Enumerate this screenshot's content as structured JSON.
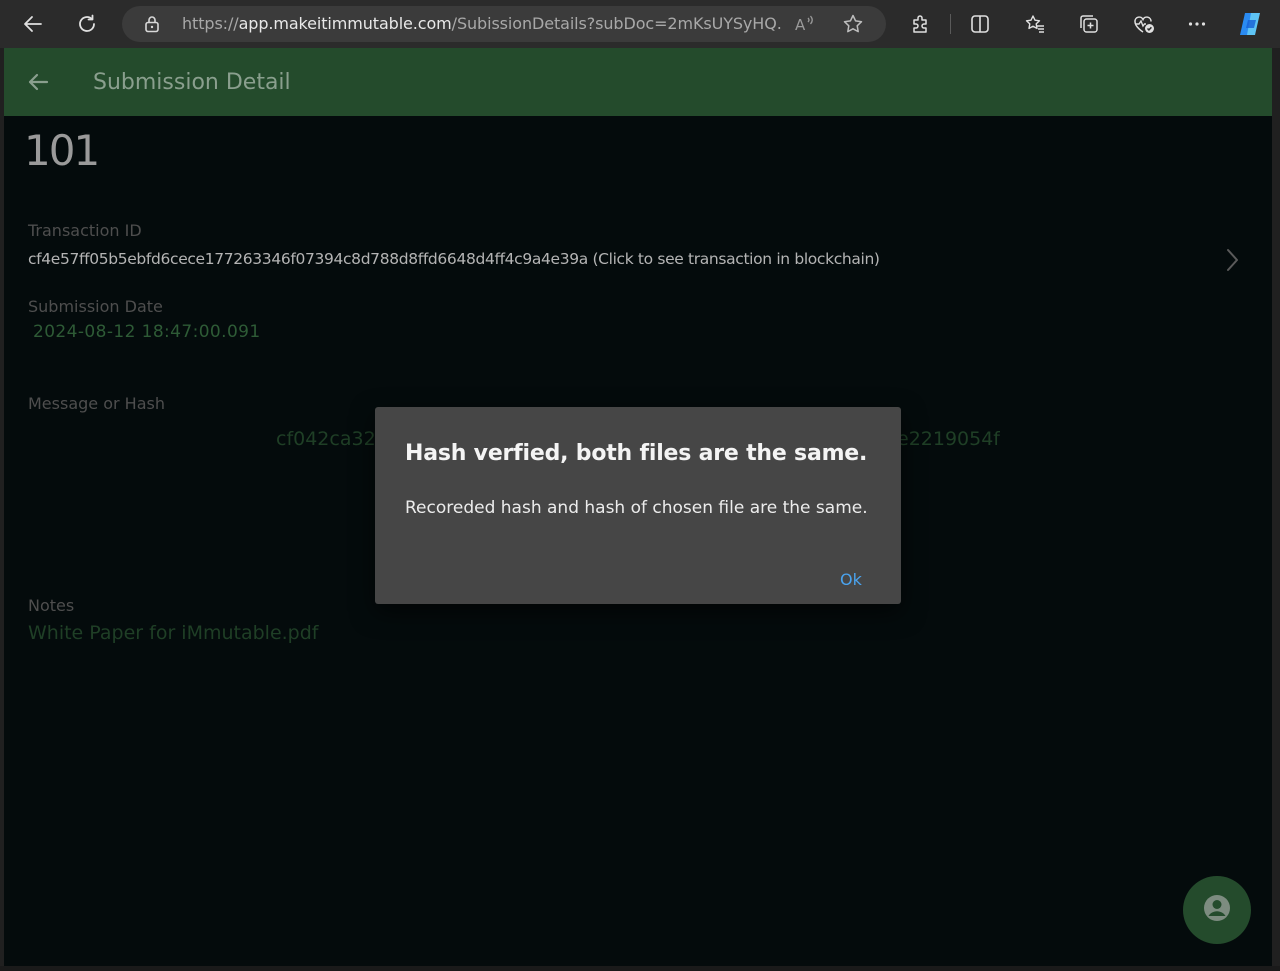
{
  "browser": {
    "url_prefix": "https://",
    "url_host": "app.makeitimmutable.com",
    "url_path": "/SubissionDetails?subDoc=2mKsUYSyHQ...",
    "read_aloud_icon": "read-aloud-icon",
    "favorite_icon": "star-icon"
  },
  "app_bar": {
    "title": "Submission Detail",
    "back_icon": "arrow-left-icon"
  },
  "submission": {
    "number": "101",
    "transaction_label": "Transaction ID",
    "transaction_value": "cf4e57ff05b5ebfd6cece177263346f07394c8d788d8ffd6648d4ff4c9a4e39a (Click to see transaction in blockchain)",
    "date_label": "Submission Date",
    "date_value": "2024-08-12 18:47:00.091",
    "hash_label": "Message or Hash",
    "hash_value_start": "cf042ca32",
    "hash_value_end": "e2219054f",
    "notes_label": "Notes",
    "notes_value": "White Paper for iMmutable.pdf"
  },
  "dialog": {
    "title": "Hash verfied, both files are the same.",
    "message": "Recoreded hash and hash of chosen file are the same.",
    "ok_label": "Ok"
  },
  "colors": {
    "app_bar": "#244b2c",
    "page_bg": "#040b0c",
    "dialog_bg": "#464646",
    "ok_accent": "#4aa3ee"
  }
}
